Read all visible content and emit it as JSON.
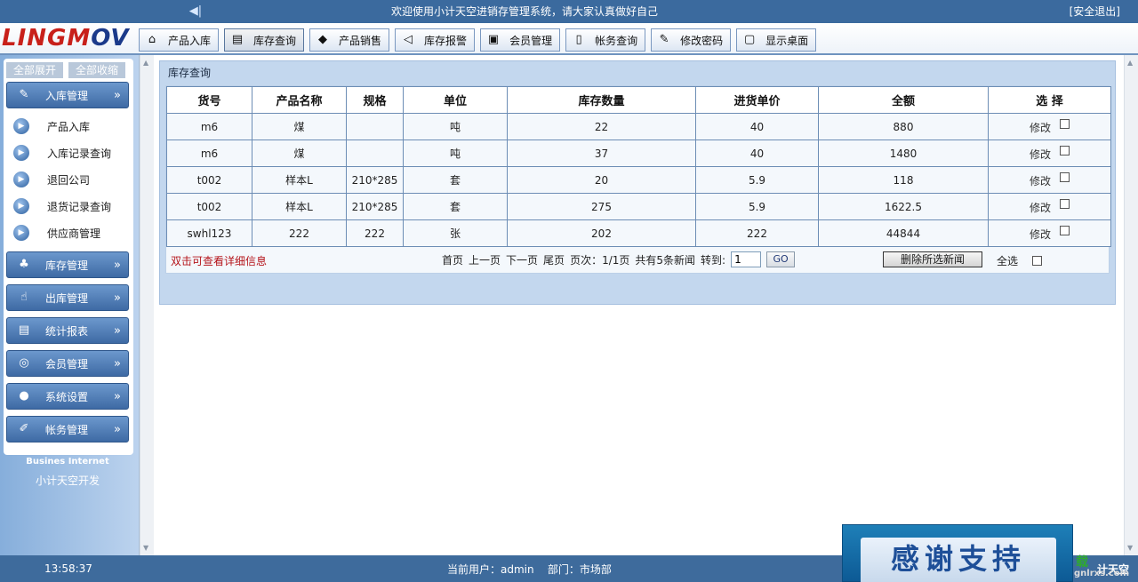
{
  "topbar": {
    "welcome": "欢迎使用小计天空进销存管理系统，请大家认真做好自己",
    "logout": "[安全退出]"
  },
  "header": {
    "logo_a": "LINGM",
    "logo_b": "OV",
    "tabs": [
      {
        "label": "产品入库",
        "icon": "house-icon"
      },
      {
        "label": "库存查询",
        "icon": "document-icon"
      },
      {
        "label": "产品销售",
        "icon": "tag-icon"
      },
      {
        "label": "库存报警",
        "icon": "speaker-icon"
      },
      {
        "label": "会员管理",
        "icon": "id-card-icon"
      },
      {
        "label": "帐务查询",
        "icon": "bottle-icon"
      },
      {
        "label": "修改密码",
        "icon": "key-icon"
      },
      {
        "label": "显示桌面",
        "icon": "desktop-icon"
      }
    ],
    "active_tab": 1
  },
  "sidebar": {
    "expand_all": "全部展开",
    "collapse_all": "全部收缩",
    "menus": [
      {
        "label": "入库管理",
        "icon": "stock-in-icon",
        "items": [
          "产品入库",
          "入库记录查询",
          "退回公司",
          "退货记录查询",
          "供应商管理"
        ]
      },
      {
        "label": "库存管理",
        "icon": "inventory-icon",
        "items": []
      },
      {
        "label": "出库管理",
        "icon": "stock-out-icon",
        "items": []
      },
      {
        "label": "统计报表",
        "icon": "report-icon",
        "items": []
      },
      {
        "label": "会员管理",
        "icon": "member-icon",
        "items": []
      },
      {
        "label": "系统设置",
        "icon": "globe-icon",
        "items": []
      },
      {
        "label": "帐务管理",
        "icon": "accounting-icon",
        "items": []
      }
    ],
    "footer_en": "Busines Internet",
    "footer_cn": "小计天空开发"
  },
  "panel": {
    "title": "库存查询",
    "columns": [
      "货号",
      "产品名称",
      "规格",
      "单位",
      "库存数量",
      "进货单价",
      "全额",
      "选 择"
    ],
    "rows": [
      {
        "code": "m6",
        "name": "煤",
        "spec": "",
        "unit": "吨",
        "qty": "22",
        "price": "40",
        "amount": "880"
      },
      {
        "code": "m6",
        "name": "煤",
        "spec": "",
        "unit": "吨",
        "qty": "37",
        "price": "40",
        "amount": "1480"
      },
      {
        "code": "t002",
        "name": "样本L",
        "spec": "210*285",
        "unit": "套",
        "qty": "20",
        "price": "5.9",
        "amount": "118"
      },
      {
        "code": "t002",
        "name": "样本L",
        "spec": "210*285",
        "unit": "套",
        "qty": "275",
        "price": "5.9",
        "amount": "1622.5"
      },
      {
        "code": "swhl123",
        "name": "222",
        "spec": "222",
        "unit": "张",
        "qty": "202",
        "price": "222",
        "amount": "44844"
      }
    ],
    "edit_label": "修改",
    "hint": "双击可查看详细信息",
    "pager": {
      "first": "首页",
      "prev": "上一页",
      "next": "下一页",
      "last": "尾页",
      "page_info": "页次：1/1页",
      "total": "共有5条新闻",
      "goto": "转到:",
      "page_value": "1",
      "go": "GO"
    },
    "delete_selected": "删除所选新闻",
    "select_all": "全选"
  },
  "bottombar": {
    "clock": "13:58:37",
    "user": "当前用户：admin",
    "dept": "部门：市场部"
  },
  "banner": {
    "text": "感谢支持"
  },
  "corner": {
    "a": "载",
    "b": "计天空",
    "c": "gnlrxs.com"
  }
}
